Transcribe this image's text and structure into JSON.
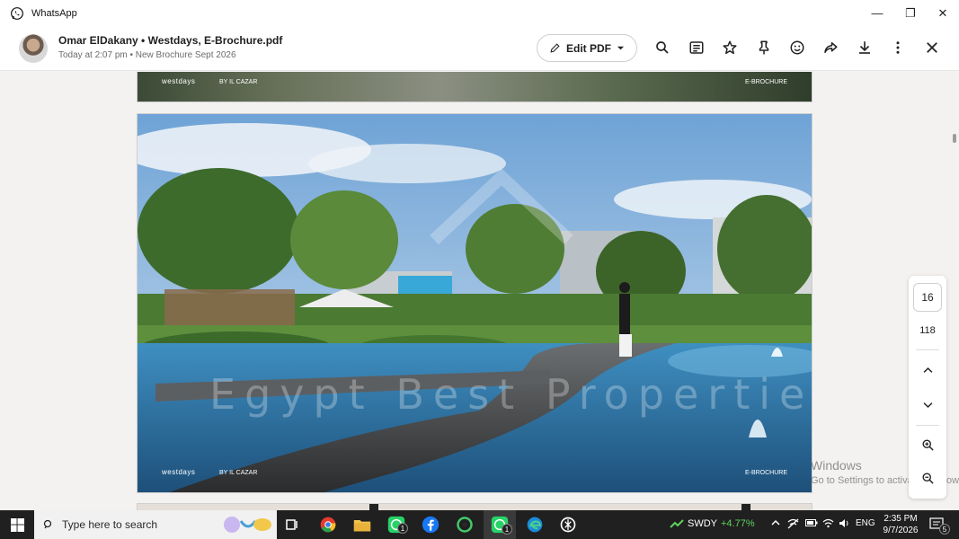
{
  "window": {
    "app_title": "WhatsApp",
    "controls": {
      "minimize": "—",
      "maximize": "❐",
      "close": "✕"
    }
  },
  "header": {
    "title": "Omar ElDakany • Westdays, E-Brochure.pdf",
    "subtitle": "Today at 2:07 pm • New Brochure Sept 2026",
    "edit_label": "Edit PDF",
    "icons": [
      "search-icon",
      "annotate-icon",
      "star-icon",
      "pin-icon",
      "emoji-icon",
      "forward-icon",
      "download-icon",
      "more-icon",
      "close-icon"
    ]
  },
  "viewer": {
    "top_page": {
      "brand_left": "westdays",
      "brand_mid": "BY IL CAZAR",
      "brand_right": "E-BROCHURE"
    },
    "main_page": {
      "brand_left": "westdays",
      "brand_mid": "BY IL CAZAR",
      "brand_right": "E-BROCHURE",
      "watermark": "Egypt Best Properties"
    },
    "activate_line1": "Windows",
    "activate_line2": "Go to Settings to activate Windows."
  },
  "page_nav": {
    "current_page": "16",
    "total_pages": "118"
  },
  "taskbar": {
    "search_placeholder": "Type here to search",
    "whatsapp_badge": "1",
    "whatsapp_active_badge": "1",
    "stock_name": "SWDY",
    "stock_change": "+4.77%",
    "language": "ENG",
    "time": "2:35 PM",
    "date": "9/7/2026",
    "notification_count": "5"
  }
}
